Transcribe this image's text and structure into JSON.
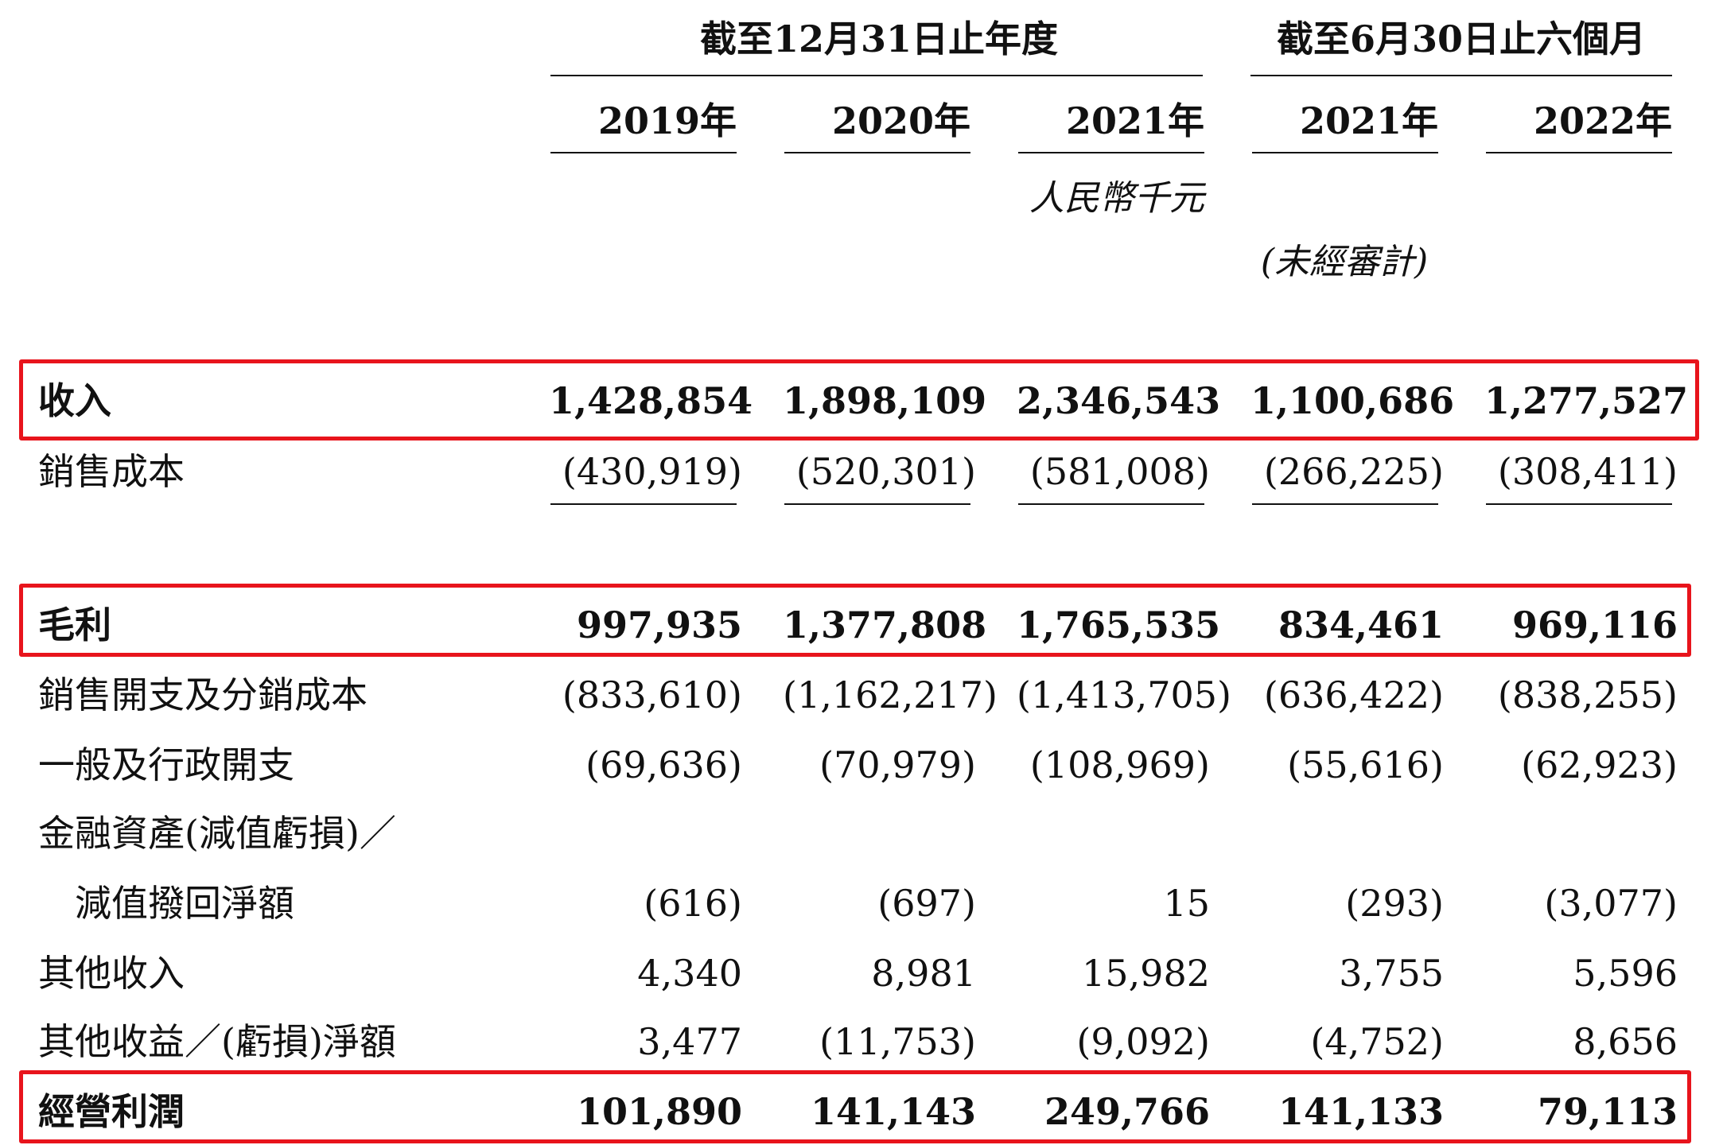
{
  "header": {
    "group_annual": "截至12月31日止年度",
    "group_interim": "截至6月30日止六個月",
    "years": [
      "2019年",
      "2020年",
      "2021年",
      "2021年",
      "2022年"
    ],
    "currency_note": "人民幣千元",
    "unaudited_note": "(未經審計)"
  },
  "rows": [
    {
      "label": "收入",
      "values": [
        "1,428,854",
        "1,898,109",
        "2,346,543",
        "1,100,686",
        "1,277,527"
      ]
    },
    {
      "label": "銷售成本",
      "values": [
        "(430,919)",
        "(520,301)",
        "(581,008)",
        "(266,225)",
        "(308,411)"
      ]
    },
    {
      "label": "毛利",
      "values": [
        "997,935",
        "1,377,808",
        "1,765,535",
        "834,461",
        "969,116"
      ]
    },
    {
      "label": "銷售開支及分銷成本",
      "values": [
        "(833,610)",
        "(1,162,217)",
        "(1,413,705)",
        "(636,422)",
        "(838,255)"
      ]
    },
    {
      "label": "一般及行政開支",
      "values": [
        "(69,636)",
        "(70,979)",
        "(108,969)",
        "(55,616)",
        "(62,923)"
      ]
    },
    {
      "label": "金融資產(減值虧損)／",
      "continuation": "減值撥回淨額",
      "values": [
        "(616)",
        "(697)",
        "15",
        "(293)",
        "(3,077)"
      ]
    },
    {
      "label": "其他收入",
      "values": [
        "4,340",
        "8,981",
        "15,982",
        "3,755",
        "5,596"
      ]
    },
    {
      "label": "其他收益／(虧損)淨額",
      "values": [
        "3,477",
        "(11,753)",
        "(9,092)",
        "(4,752)",
        "8,656"
      ]
    },
    {
      "label": "經營利潤",
      "values": [
        "101,890",
        "141,143",
        "249,766",
        "141,133",
        "79,113"
      ]
    }
  ],
  "colors": {
    "highlight_border": "#e8141c",
    "text": "#111111"
  }
}
